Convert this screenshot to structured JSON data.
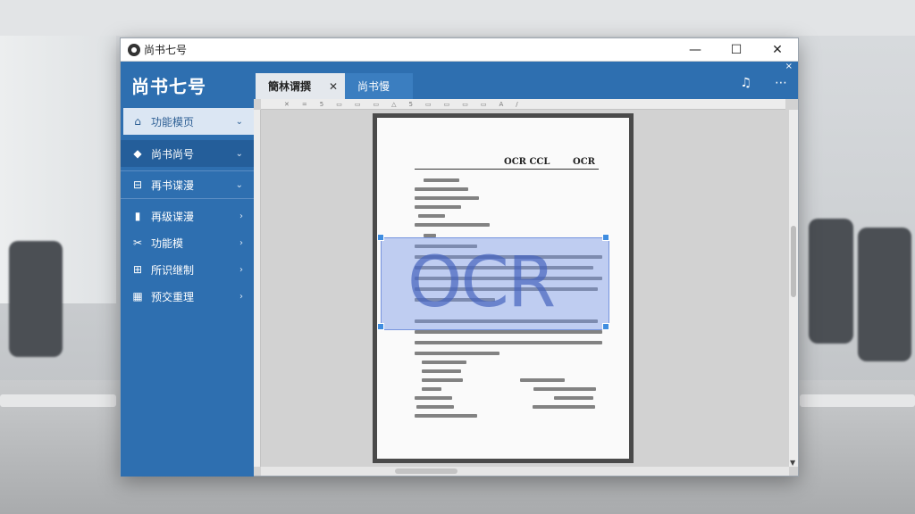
{
  "window": {
    "title": "尚书七号"
  },
  "window_controls": {
    "minimize": "—",
    "maximize": "☐",
    "close": "✕"
  },
  "sidebar": {
    "brand": "尚书七号",
    "items": [
      {
        "label": "功能模页",
        "icon": "home-icon",
        "chevron": "⌄"
      },
      {
        "label": "尚书尚号",
        "icon": "gem-icon",
        "chevron": "⌄"
      },
      {
        "label": "再书谍漫",
        "icon": "minus-box-icon",
        "chevron": "⌄"
      },
      {
        "label": "再级谍漫",
        "icon": "document-icon",
        "chevron": "›"
      },
      {
        "label": "功能模",
        "icon": "scissors-icon",
        "chevron": "›"
      },
      {
        "label": "所识继制",
        "icon": "table-icon",
        "chevron": "›"
      },
      {
        "label": "预交重理",
        "icon": "grid-icon",
        "chevron": "›"
      }
    ]
  },
  "tabs": [
    {
      "label": "簡林谓撰",
      "close": "✕"
    },
    {
      "label": "尚书慢"
    }
  ],
  "toolbar": {
    "bell": "🔔",
    "more": "⋯",
    "close_x": "×"
  },
  "document": {
    "header_left": "OCR CCL",
    "header_right": "OCR",
    "overlay_text": "OCR"
  },
  "ruler_marks": [
    "✕",
    "=",
    "5",
    "▭",
    "▭",
    "▭",
    "△",
    "5",
    "▭",
    "▭",
    "▭",
    "▭",
    "A",
    "/"
  ]
}
